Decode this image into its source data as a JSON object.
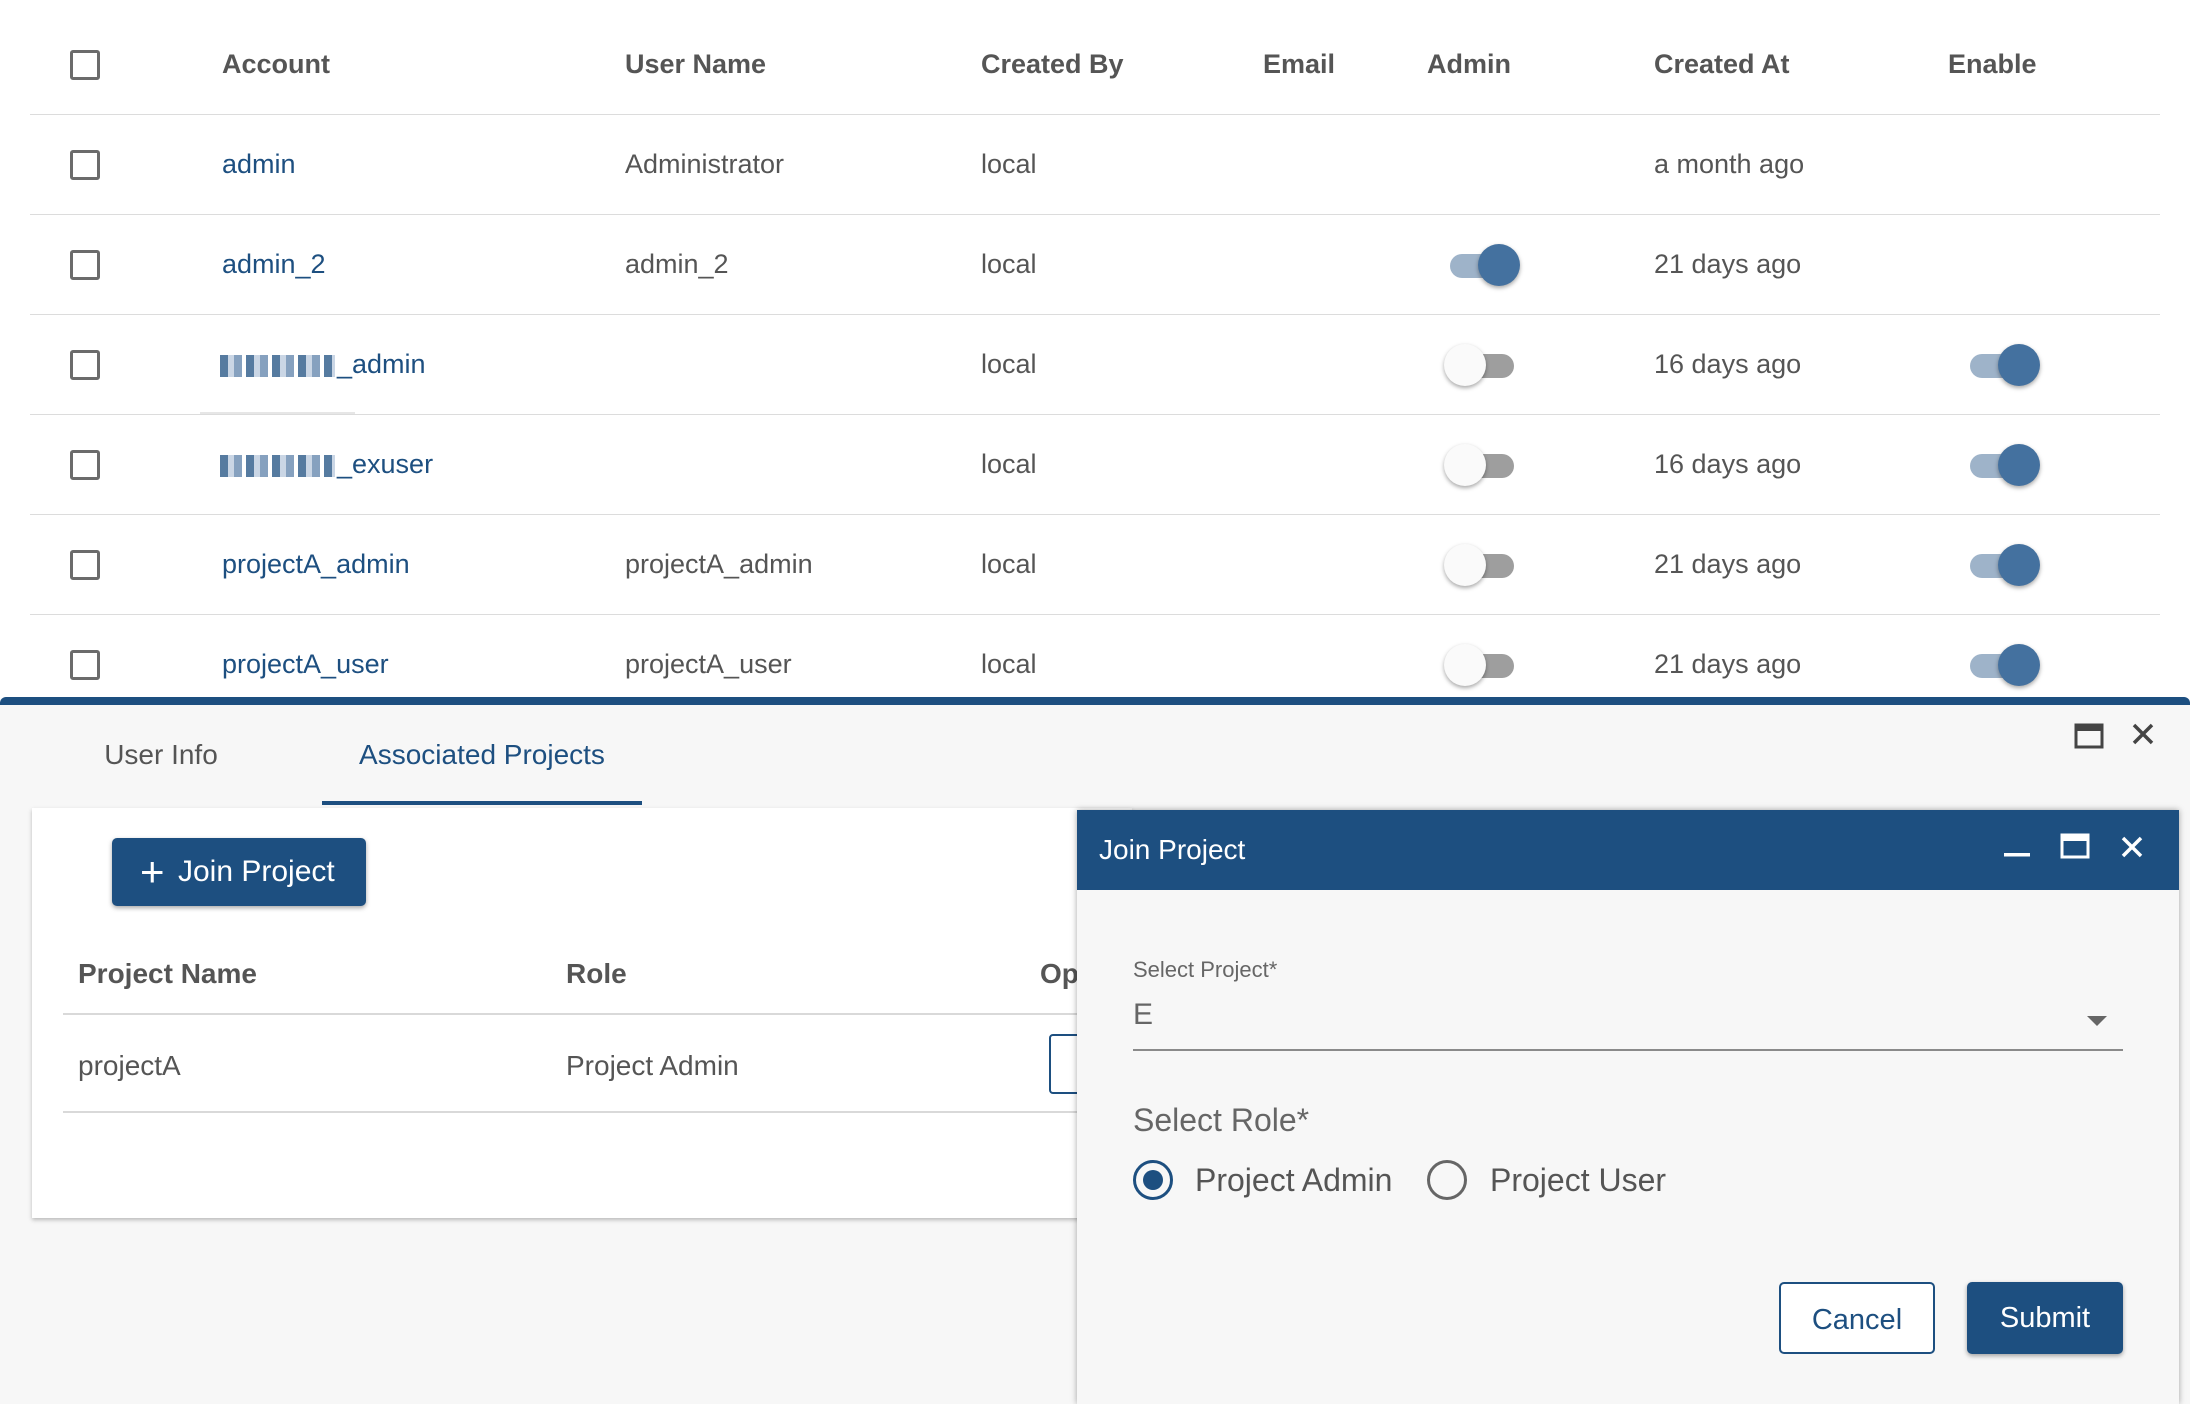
{
  "users_table": {
    "columns": [
      "Account",
      "User Name",
      "Created By",
      "Email",
      "Admin",
      "Created At",
      "Enable"
    ],
    "rows": [
      {
        "account": "admin",
        "user_name": "Administrator",
        "created_by": "local",
        "created_at": "a month ago",
        "admin": null,
        "enable": null
      },
      {
        "account": "admin_2",
        "user_name": "admin_2",
        "created_by": "local",
        "created_at": "21 days ago",
        "admin": true,
        "enable": null
      },
      {
        "account": "_admin",
        "user_name": "",
        "created_by": "local",
        "created_at": "16 days ago",
        "admin": false,
        "enable": true
      },
      {
        "account": "_exuser",
        "user_name": "",
        "created_by": "local",
        "created_at": "16 days ago",
        "admin": false,
        "enable": true
      },
      {
        "account": "projectA_admin",
        "user_name": "projectA_admin",
        "created_by": "local",
        "created_at": "21 days ago",
        "admin": false,
        "enable": true
      },
      {
        "account": "projectA_user",
        "user_name": "projectA_user",
        "created_by": "local",
        "created_at": "21 days ago",
        "admin": false,
        "enable": true
      }
    ]
  },
  "panel": {
    "tabs": [
      "User Info",
      "Associated Projects"
    ],
    "active_tab": "Associated Projects",
    "join_button_label": "Join Project",
    "projects_table": {
      "columns": [
        "Project Name",
        "Role",
        "Op"
      ],
      "rows": [
        {
          "project_name": "projectA",
          "role": "Project Admin"
        }
      ]
    }
  },
  "dialog": {
    "title": "Join Project",
    "select_project_label": "Select Project",
    "select_project_value": "E",
    "select_role_label": "Select Role",
    "required_mark": "*",
    "role_options": [
      "Project Admin",
      "Project User"
    ],
    "selected_role": "Project Admin",
    "cancel_label": "Cancel",
    "submit_label": "Submit"
  },
  "colors": {
    "accent": "#1d4f80",
    "toggle_on": "#44719f",
    "toggle_off": "#9e9e9e"
  },
  "icons": [
    "maximize-icon",
    "close-icon",
    "minimize-icon",
    "plus-icon",
    "chevron-down-icon"
  ]
}
